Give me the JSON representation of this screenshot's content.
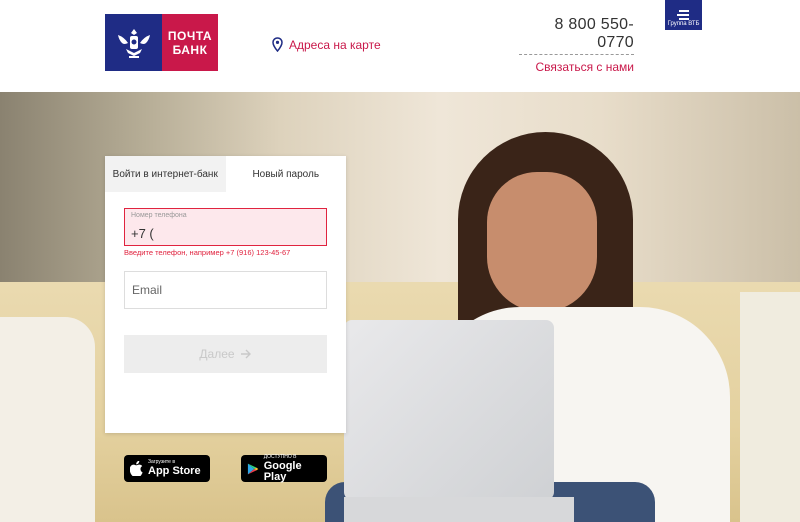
{
  "header": {
    "logo_line1": "ПОЧТА",
    "logo_line2": "БАНК",
    "map_link": "Адреса на карте",
    "phone": "8 800 550-0770",
    "contact": "Связаться с нами",
    "vtb_label": "Группа ВТБ"
  },
  "login": {
    "tabs": [
      {
        "label": "Войти в интернет-банк",
        "active": false
      },
      {
        "label": "Новый пароль",
        "active": true
      }
    ],
    "phone_label": "Номер телефона",
    "phone_value": "+7 (",
    "phone_error": "Введите телефон, например +7 (916) 123-45-67",
    "email_placeholder": "Email",
    "submit": "Далее"
  },
  "stores": {
    "apple_small": "Загрузите в",
    "apple_big": "App Store",
    "google_small": "ДОСТУПНО В",
    "google_big": "Google Play"
  },
  "colors": {
    "brand_blue": "#1f2c85",
    "brand_red": "#c9184a",
    "error": "#e0233f"
  },
  "icons": [
    "russian-eagle-emblem",
    "map-pin-icon",
    "vtb-logo",
    "arrow-right-icon",
    "apple-icon",
    "google-play-icon"
  ]
}
